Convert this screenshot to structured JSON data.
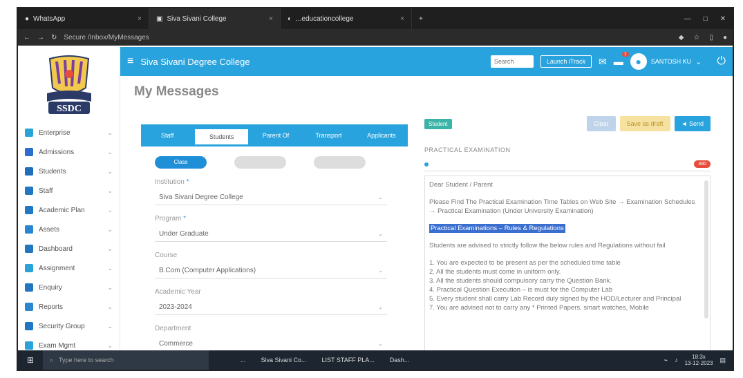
{
  "browser": {
    "tabs": [
      {
        "label": "WhatsApp"
      },
      {
        "label": "Siva Sivani College"
      },
      {
        "label": "...educationcollege"
      }
    ],
    "new_tab": "+",
    "window_controls": [
      "—",
      "□",
      "✕"
    ],
    "address": "Secure  /Inbox/MyMessages"
  },
  "header": {
    "college_name": "Siva Sivani Degree College",
    "search_placeholder": "Search",
    "launch_label": "Launch iTrack",
    "notif_count": "1",
    "user_name": "SANTOSH KU"
  },
  "sidebar": {
    "logo_text": "SSDC",
    "items": [
      {
        "label": "Enterprise",
        "color": "#2aa4d8"
      },
      {
        "label": "Admissions",
        "color": "#2a6fc9"
      },
      {
        "label": "Students",
        "color": "#1f6fb8"
      },
      {
        "label": "Staff",
        "color": "#2277c2"
      },
      {
        "label": "Academic Plan",
        "color": "#2277c2"
      },
      {
        "label": "Assets",
        "color": "#2a86d1"
      },
      {
        "label": "Dashboard",
        "color": "#2277c2"
      },
      {
        "label": "Assignment",
        "color": "#2aa4d8"
      },
      {
        "label": "Enquiry",
        "color": "#2277c2"
      },
      {
        "label": "Reports",
        "color": "#2a86d1"
      },
      {
        "label": "Security Group",
        "color": "#2277c2"
      },
      {
        "label": "Exam Mgmt",
        "color": "#2aa4d8"
      }
    ]
  },
  "page": {
    "title": "My Messages"
  },
  "left": {
    "tabs": [
      "Staff",
      "Students",
      "Parent Of",
      "Transport",
      "Applicants"
    ],
    "pills": [
      "Class",
      "",
      ""
    ],
    "fields": [
      {
        "label": "Institution",
        "required": "*",
        "value": "Siva Sivani Degree College"
      },
      {
        "label": "Program",
        "required": "*",
        "value": "Under Graduate"
      },
      {
        "label": "Course",
        "required": "",
        "value": "B.Com (Computer Applications)"
      },
      {
        "label": "Academic Year",
        "required": "",
        "value": "2023-2024"
      },
      {
        "label": "Department",
        "required": "",
        "value": "Commerce"
      }
    ]
  },
  "right": {
    "chip": "Student",
    "buttons": {
      "clear": "Clear",
      "draft": "Save as draft",
      "send": "Send"
    },
    "subject": "PRACTICAL EXAMINATION",
    "count": "480",
    "body": {
      "greeting": "Dear Student / Parent",
      "para1": "Please Find The Practical Examination Time Tables on Web Site → Examination Schedules → Practical Examination (Under University Examination)",
      "highlight": "Practical Examinations – Rules & Regulations",
      "para2": "Students are advised to strictly follow the below rules and Regulations without fail",
      "rules": [
        "1.   You are expected to be present as per the scheduled time table",
        "2.   All the students must come in uniform only.",
        "3.   All the students should compulsory carry the Question Bank.",
        "4.   Practical Question Execution – is must for the Computer Lab",
        "5.   Every student shall carry Lab Record duly signed by the HOD/Lecturer and Principal",
        "7.   You are advised not to carry any * Printed Papers, smart watches, Mobile"
      ]
    }
  },
  "taskbar": {
    "search": "Type here to search",
    "tasks": [
      "...",
      "Siva Sivani Co...",
      "LIST STAFF PLA...",
      "Dash..."
    ],
    "time": "18:3x",
    "date": "13-12-2023"
  }
}
